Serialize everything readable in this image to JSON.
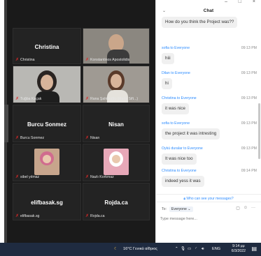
{
  "window": {
    "minimize": "–",
    "maximize": "□",
    "close": "×"
  },
  "gallery": {
    "tiles": [
      {
        "name": "Christina",
        "label": "Christina"
      },
      {
        "name": "",
        "label": "Konstantinos Apostolidis"
      },
      {
        "name": "",
        "label": "Tuğba Kaçak"
      },
      {
        "name": "",
        "label": "Rana Şahinoğlu (Maria Sift...)"
      },
      {
        "name": "Burcu Sonmez",
        "label": "Burcu Sonmez"
      },
      {
        "name": "Nisan",
        "label": "Nisan"
      },
      {
        "name": "",
        "label": "sibel yılmaz"
      },
      {
        "name": "",
        "label": "Nazlı Korkmaz"
      },
      {
        "name": "elifbasak.sg",
        "label": "elifbasak.sg"
      },
      {
        "name": "Rojda.ca",
        "label": "Rojda.ca"
      }
    ]
  },
  "chat": {
    "title": "Chat",
    "messages": [
      {
        "sender": "",
        "time": "",
        "text": "How do you think the Project was??"
      },
      {
        "sender": "sofia to Everyone",
        "time": "09:13 PM",
        "text": "hiii"
      },
      {
        "sender": "Dilan to Everyone",
        "time": "09:13 PM",
        "text": "hi"
      },
      {
        "sender": "Christina to Everyone",
        "time": "09:13 PM",
        "text": "it was nice"
      },
      {
        "sender": "sofia to Everyone",
        "time": "09:13 PM",
        "text": "the project it was intresting"
      },
      {
        "sender": "Oykü duralar to Everyone",
        "time": "09:13 PM",
        "text": "It was nice too"
      },
      {
        "sender": "Christina to Everyone",
        "time": "09:14 PM",
        "text": "indeed yess it was"
      }
    ],
    "who_can_see": "Who can see your messages?",
    "to_label": "To:",
    "recipient": "Everyone",
    "input_placeholder": "Type message here..."
  },
  "taskbar": {
    "weather": "16°C Γενικά αίθριος",
    "language": "ENG",
    "time": "9:14 μμ",
    "date": "6/3/2022"
  },
  "colors": {
    "accent": "#2d8cff",
    "mute": "#e02828",
    "taskbar": "#1f2b40"
  }
}
